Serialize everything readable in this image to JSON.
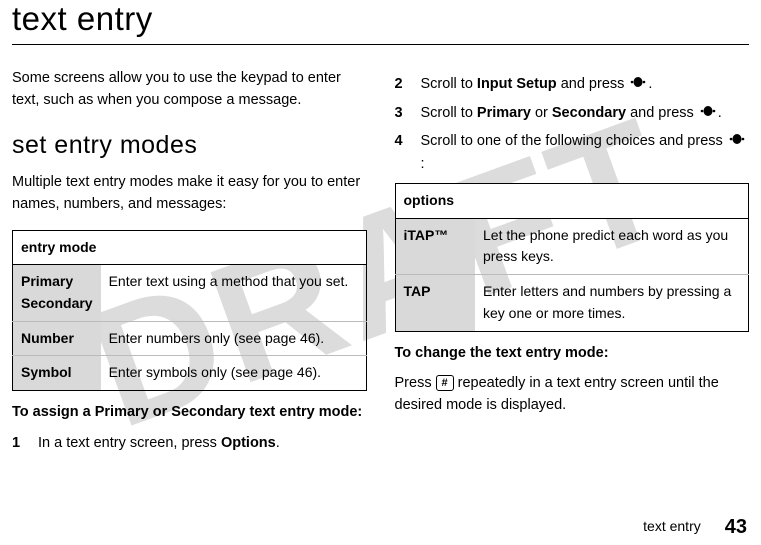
{
  "watermark": "DRAFT",
  "title": "text entry",
  "intro": "Some screens allow you to use the keypad to enter text, such as when you compose a message.",
  "section_heading": "set entry modes",
  "section_intro": "Multiple text entry modes make it easy for you to enter names, numbers, and messages:",
  "entry_table": {
    "header": "entry mode",
    "rows": [
      {
        "label": "Primary\nSecondary",
        "desc": "Enter text using a method that you set."
      },
      {
        "label": "Number",
        "desc": "Enter numbers only (see page 46)."
      },
      {
        "label": "Symbol",
        "desc": "Enter symbols only (see page 46)."
      }
    ]
  },
  "assign_heading": "To assign a Primary or Secondary text entry mode:",
  "steps_left": [
    {
      "num": "1",
      "pre": "In a text entry screen, press ",
      "menu": "Options",
      "post": "."
    }
  ],
  "steps_right": [
    {
      "num": "2",
      "pre": "Scroll to ",
      "menu": "Input Setup",
      "mid": " and press ",
      "icon": "nav",
      "post": "."
    },
    {
      "num": "3",
      "pre": "Scroll to ",
      "menu": "Primary",
      "mid2": " or ",
      "menu2": "Secondary",
      "mid": " and press ",
      "icon": "nav",
      "post": "."
    },
    {
      "num": "4",
      "pre": "Scroll to one of the following choices and press ",
      "icon": "nav",
      "post": ":"
    }
  ],
  "options_table": {
    "header": "options",
    "rows": [
      {
        "label": "iTAP™",
        "desc": "Let the phone predict each word as you press keys."
      },
      {
        "label": "TAP",
        "desc": "Enter letters and numbers by pressing a key one or more times."
      }
    ]
  },
  "change_heading": "To change the text entry mode:",
  "change_text_pre": "Press ",
  "change_key": "#",
  "change_text_post": " repeatedly in a text entry screen until the desired mode is displayed.",
  "footer_section": "text entry",
  "footer_page": "43"
}
